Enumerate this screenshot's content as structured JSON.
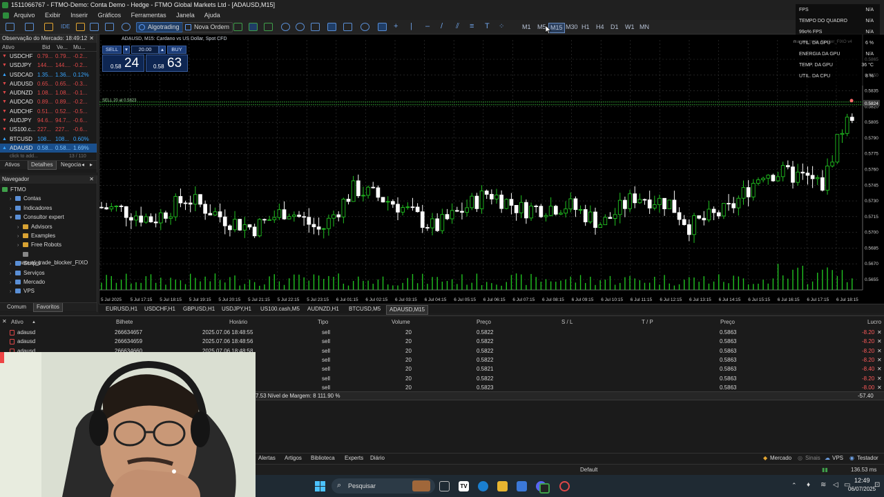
{
  "window": {
    "title": "1511066767 - FTMO-Demo: Conta Demo - Hedge - FTMO Global Markets Ltd - [ADAUSD,M15]"
  },
  "menu": [
    "Arquivo",
    "Exibir",
    "Inserir",
    "Gráficos",
    "Ferramentas",
    "Janela",
    "Ajuda"
  ],
  "toolbar": {
    "algotrading": "Algotrading",
    "nova_ordem": "Nova Ordem",
    "timeframes": [
      "M1",
      "M5",
      "M15",
      "M30",
      "H1",
      "H4",
      "D1",
      "W1",
      "MN"
    ],
    "active_timeframe": "M15",
    "ide": "IDE"
  },
  "overlay": [
    {
      "label": "FPS",
      "value": "N/A"
    },
    {
      "label": "TEMPO DO QUADRO",
      "value": "N/A"
    },
    {
      "label": "99o% FPS",
      "value": "N/A"
    },
    {
      "label": "UTIL. DA GPU",
      "value": "6 %"
    },
    {
      "label": "ENERGIA DA GPU",
      "value": "N/A"
    },
    {
      "label": "TEMP. DA GPU",
      "value": "36 °C"
    },
    {
      "label": "UTIL. DA CPU",
      "value": "8 %"
    }
  ],
  "market_watch": {
    "title": "Observação do Mercado: 18:49:12",
    "columns": [
      "Ativo",
      "Bid",
      "Ve...",
      "Mu..."
    ],
    "rows": [
      {
        "symbol": "USDCHF",
        "bid": "0.79...",
        "ask": "0.79...",
        "chg": "-0.2...",
        "dir": "down"
      },
      {
        "symbol": "USDJPY",
        "bid": "144....",
        "ask": "144....",
        "chg": "-0.2...",
        "dir": "down"
      },
      {
        "symbol": "USDCAD",
        "bid": "1.35...",
        "ask": "1.36...",
        "chg": "0.12%",
        "dir": "up"
      },
      {
        "symbol": "AUDUSD",
        "bid": "0.65...",
        "ask": "0.65...",
        "chg": "-0.3...",
        "dir": "down"
      },
      {
        "symbol": "AUDNZD",
        "bid": "1.08...",
        "ask": "1.08...",
        "chg": "-0.1...",
        "dir": "down"
      },
      {
        "symbol": "AUDCAD",
        "bid": "0.89...",
        "ask": "0.89...",
        "chg": "-0.2...",
        "dir": "down"
      },
      {
        "symbol": "AUDCHF",
        "bid": "0.51...",
        "ask": "0.52...",
        "chg": "-0.5...",
        "dir": "down"
      },
      {
        "symbol": "AUDJPY",
        "bid": "94.6...",
        "ask": "94.7...",
        "chg": "-0.6...",
        "dir": "down"
      },
      {
        "symbol": "US100.c...",
        "bid": "227...",
        "ask": "227...",
        "chg": "-0.6...",
        "dir": "down"
      },
      {
        "symbol": "BTCUSD",
        "bid": "108...",
        "ask": "108...",
        "chg": "0.60%",
        "dir": "up"
      },
      {
        "symbol": "ADAUSD",
        "bid": "0.58...",
        "ask": "0.58...",
        "chg": "1.69%",
        "dir": "up",
        "selected": true
      }
    ],
    "add_hint": "click to add...",
    "count": "13 / 110",
    "tabs": [
      "Ativos",
      "Detalhes",
      "Negocia"
    ]
  },
  "navigator": {
    "title": "Navegador",
    "items": [
      {
        "label": "FTMO",
        "indent": 0
      },
      {
        "label": "Contas",
        "indent": 1
      },
      {
        "label": "Indicadores",
        "indent": 1
      },
      {
        "label": "Consultor expert",
        "indent": 1
      },
      {
        "label": "Advisors",
        "indent": 2
      },
      {
        "label": "Examples",
        "indent": 2
      },
      {
        "label": "Free Robots",
        "indent": 2
      },
      {
        "label": "manual_trade_blocker_FIXO",
        "indent": 2
      },
      {
        "label": "Scripts",
        "indent": 1
      },
      {
        "label": "Serviços",
        "indent": 1
      },
      {
        "label": "Mercado",
        "indent": 1
      },
      {
        "label": "VPS",
        "indent": 1
      }
    ],
    "tabs": [
      "Comum",
      "Favoritos"
    ]
  },
  "chart": {
    "title": "ADAUSD, M15:  Cardano vs US Dollar, Spot CFD",
    "trade": {
      "sell_label": "SELL",
      "buy_label": "BUY",
      "volume": "20.00",
      "sell_small": "0.58",
      "sell_big": "24",
      "buy_small": "0.58",
      "buy_big": "63"
    },
    "sell_line_label": "SELL 20 at 0.5823",
    "current_price": "0.5824",
    "ea_label": "manual_trade_blocker_FIXO v4",
    "price_labels": [
      "0.5865",
      "0.5850",
      "0.5835",
      "0.5820",
      "0.5805",
      "0.5790",
      "0.5775",
      "0.5760",
      "0.5745",
      "0.5730",
      "0.5715",
      "0.5700",
      "0.5685",
      "0.5670",
      "0.5655"
    ],
    "time_labels": [
      "5 Jul 2025",
      "5 Jul 17:15",
      "5 Jul 18:15",
      "5 Jul 19:15",
      "5 Jul 20:15",
      "5 Jul 21:15",
      "5 Jul 22:15",
      "5 Jul 23:15",
      "6 Jul 01:15",
      "6 Jul 02:15",
      "6 Jul 03:15",
      "6 Jul 04:15",
      "6 Jul 05:15",
      "6 Jul 06:15",
      "6 Jul 07:15",
      "6 Jul 08:15",
      "6 Jul 09:15",
      "6 Jul 10:15",
      "6 Jul 11:15",
      "6 Jul 12:15",
      "6 Jul 13:15",
      "6 Jul 14:15",
      "6 Jul 15:15",
      "6 Jul 16:15",
      "6 Jul 17:15",
      "6 Jul 18:15"
    ]
  },
  "chart_tabs": [
    "EURUSD,H1",
    "USDCHF,H1",
    "GBPUSD,H1",
    "USDJPY,H1",
    "US100.cash,M5",
    "AUDNZD,H1",
    "BTCUSD,M5",
    "ADAUSD,M15"
  ],
  "toolbox": {
    "columns": [
      "Ativo",
      "Bilhete",
      "Horário",
      "Tipo",
      "Volume",
      "Preço",
      "S / L",
      "T / P",
      "Preço",
      "Lucro"
    ],
    "rows": [
      {
        "symbol": "adausd",
        "ticket": "266634657",
        "time": "2025.07.06 18:48:55",
        "type": "sell",
        "volume": "20",
        "price": "0.5822",
        "cur": "0.5863",
        "profit": "-8.20"
      },
      {
        "symbol": "adausd",
        "ticket": "266634659",
        "time": "2025.07.06 18:48:56",
        "type": "sell",
        "volume": "20",
        "price": "0.5822",
        "cur": "0.5863",
        "profit": "-8.20"
      },
      {
        "symbol": "adausd",
        "ticket": "266634660",
        "time": "2025.07.06 18:48:58",
        "type": "sell",
        "volume": "20",
        "price": "0.5822",
        "cur": "0.5863",
        "profit": "-8.20"
      },
      {
        "symbol": "",
        "ticket": "",
        "time": "",
        "type": "sell",
        "volume": "20",
        "price": "0.5822",
        "cur": "0.5863",
        "profit": "-8.20"
      },
      {
        "symbol": "",
        "ticket": "",
        "time": "",
        "type": "sell",
        "volume": "20",
        "price": "0.5821",
        "cur": "0.5863",
        "profit": "-8.40"
      },
      {
        "symbol": "",
        "ticket": "",
        "time": "",
        "type": "sell",
        "volume": "20",
        "price": "0.5822",
        "cur": "0.5863",
        "profit": "-8.20"
      },
      {
        "symbol": "",
        "ticket": "",
        "time": "",
        "type": "sell",
        "volume": "20",
        "price": "0.5823",
        "cur": "0.5863",
        "profit": "-8.00"
      }
    ],
    "summary_text": "7.53  Nível de Margem: 8 111.90 %",
    "summary_total": "-57.40",
    "tabs": [
      "Alertas",
      "Artigos",
      "Biblioteca",
      "Experts",
      "Diário"
    ]
  },
  "statusbar": {
    "profile": "Default",
    "mercado": "Mercado",
    "sinais": "Sinais",
    "vps": "VPS",
    "testador": "Testador",
    "ping": "136.53 ms"
  },
  "taskbar": {
    "search": "Pesquisar",
    "time": "12:49",
    "date": "06/07/2025"
  },
  "colors": {
    "bull": "#21c321",
    "bear": "#ffffff",
    "accent": "#3e6fb0",
    "loss": "#ff5a5a"
  }
}
